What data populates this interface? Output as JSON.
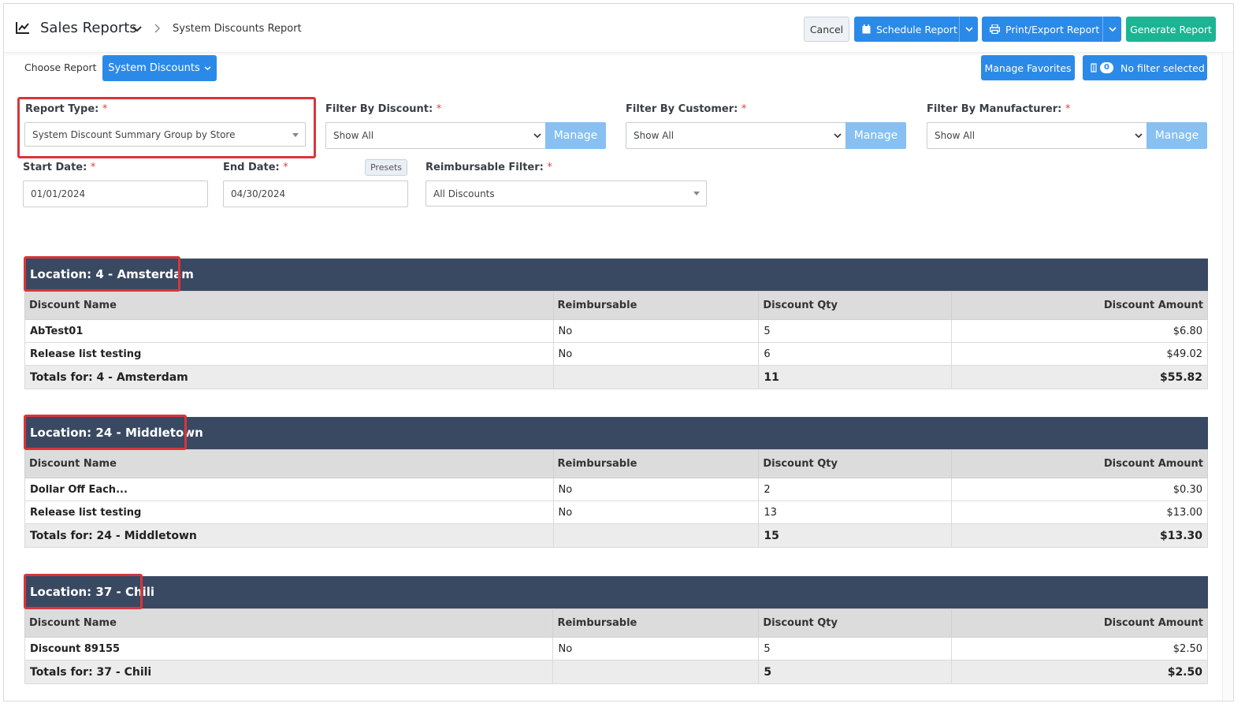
{
  "header": {
    "app_title": "Sales Reports",
    "breadcrumb": "System Discounts Report",
    "buttons": {
      "cancel": "Cancel",
      "schedule": "Schedule Report",
      "print_export": "Print/Export Report",
      "generate": "Generate Report"
    },
    "colors": {
      "primary": "#2b8ae8",
      "success": "#1bb594",
      "section_header": "#3a4962",
      "highlight": "#d9353a"
    }
  },
  "toolbar": {
    "choose_report_label": "Choose Report",
    "selected_report": "System Discounts",
    "manage_favorites": "Manage Favorites",
    "filter_count": "0",
    "filter_status": "No filter selected"
  },
  "form": {
    "report_type": {
      "label": "Report Type:",
      "value": "System Discount Summary Group by Store"
    },
    "filter_discount": {
      "label": "Filter By Discount:",
      "value": "Show All",
      "manage": "Manage"
    },
    "filter_customer": {
      "label": "Filter By Customer:",
      "value": "Show All",
      "manage": "Manage"
    },
    "filter_manufacturer": {
      "label": "Filter By Manufacturer:",
      "value": "Show All",
      "manage": "Manage"
    },
    "start_date": {
      "label": "Start Date:",
      "value": "01/01/2024"
    },
    "end_date": {
      "label": "End Date:",
      "value": "04/30/2024"
    },
    "presets": "Presets",
    "reimbursable_filter": {
      "label": "Reimbursable Filter:",
      "value": "All Discounts"
    },
    "required_mark": "*"
  },
  "report": {
    "columns": [
      "Discount Name",
      "Reimbursable",
      "Discount Qty",
      "Discount Amount"
    ],
    "locations": [
      {
        "title": "Location: 4 - Amsterdam",
        "rows": [
          {
            "name": "AbTest01",
            "reimbursable": "No",
            "qty": "5",
            "amount": "$6.80"
          },
          {
            "name": "Release list testing",
            "reimbursable": "No",
            "qty": "6",
            "amount": "$49.02"
          }
        ],
        "totals": {
          "label": "Totals for: 4 - Amsterdam",
          "qty": "11",
          "amount": "$55.82"
        }
      },
      {
        "title": "Location: 24 - Middletown",
        "rows": [
          {
            "name": "Dollar Off Each...",
            "reimbursable": "No",
            "qty": "2",
            "amount": "$0.30"
          },
          {
            "name": "Release list testing",
            "reimbursable": "No",
            "qty": "13",
            "amount": "$13.00"
          }
        ],
        "totals": {
          "label": "Totals for: 24 - Middletown",
          "qty": "15",
          "amount": "$13.30"
        }
      },
      {
        "title": "Location: 37 - Chili",
        "rows": [
          {
            "name": "Discount 89155",
            "reimbursable": "No",
            "qty": "5",
            "amount": "$2.50"
          }
        ],
        "totals": {
          "label": "Totals for: 37 - Chili",
          "qty": "5",
          "amount": "$2.50"
        }
      }
    ]
  }
}
